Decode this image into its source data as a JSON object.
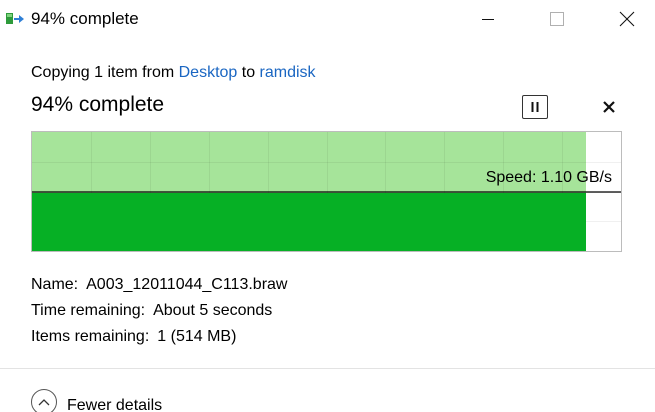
{
  "window": {
    "title": "94% complete",
    "controls": [
      "minimize-icon",
      "maximize-icon",
      "close-icon"
    ]
  },
  "header": {
    "prefix": "Copying 1 item from ",
    "source": "Desktop",
    "middle": " to ",
    "destination": "ramdisk",
    "percent_heading": "94% complete",
    "pause_icon": "pause-icon",
    "cancel_icon": "cancel-x-icon"
  },
  "progress": {
    "fraction_complete": 0.94,
    "speed_label": "Speed: 1.10 GB/s",
    "colors": {
      "done_fill": "#06b025",
      "history_fill": "#a6e49a",
      "speed_line": "#000000"
    }
  },
  "details": {
    "name_key": "Name:",
    "name_value": "A003_12011044_C113.braw",
    "time_key": "Time remaining:",
    "time_value": "About 5 seconds",
    "items_key": "Items remaining:",
    "items_value": "1 (514 MB)"
  },
  "footer": {
    "toggle_label": "Fewer details",
    "toggle_icon": "chevron-up-icon"
  }
}
